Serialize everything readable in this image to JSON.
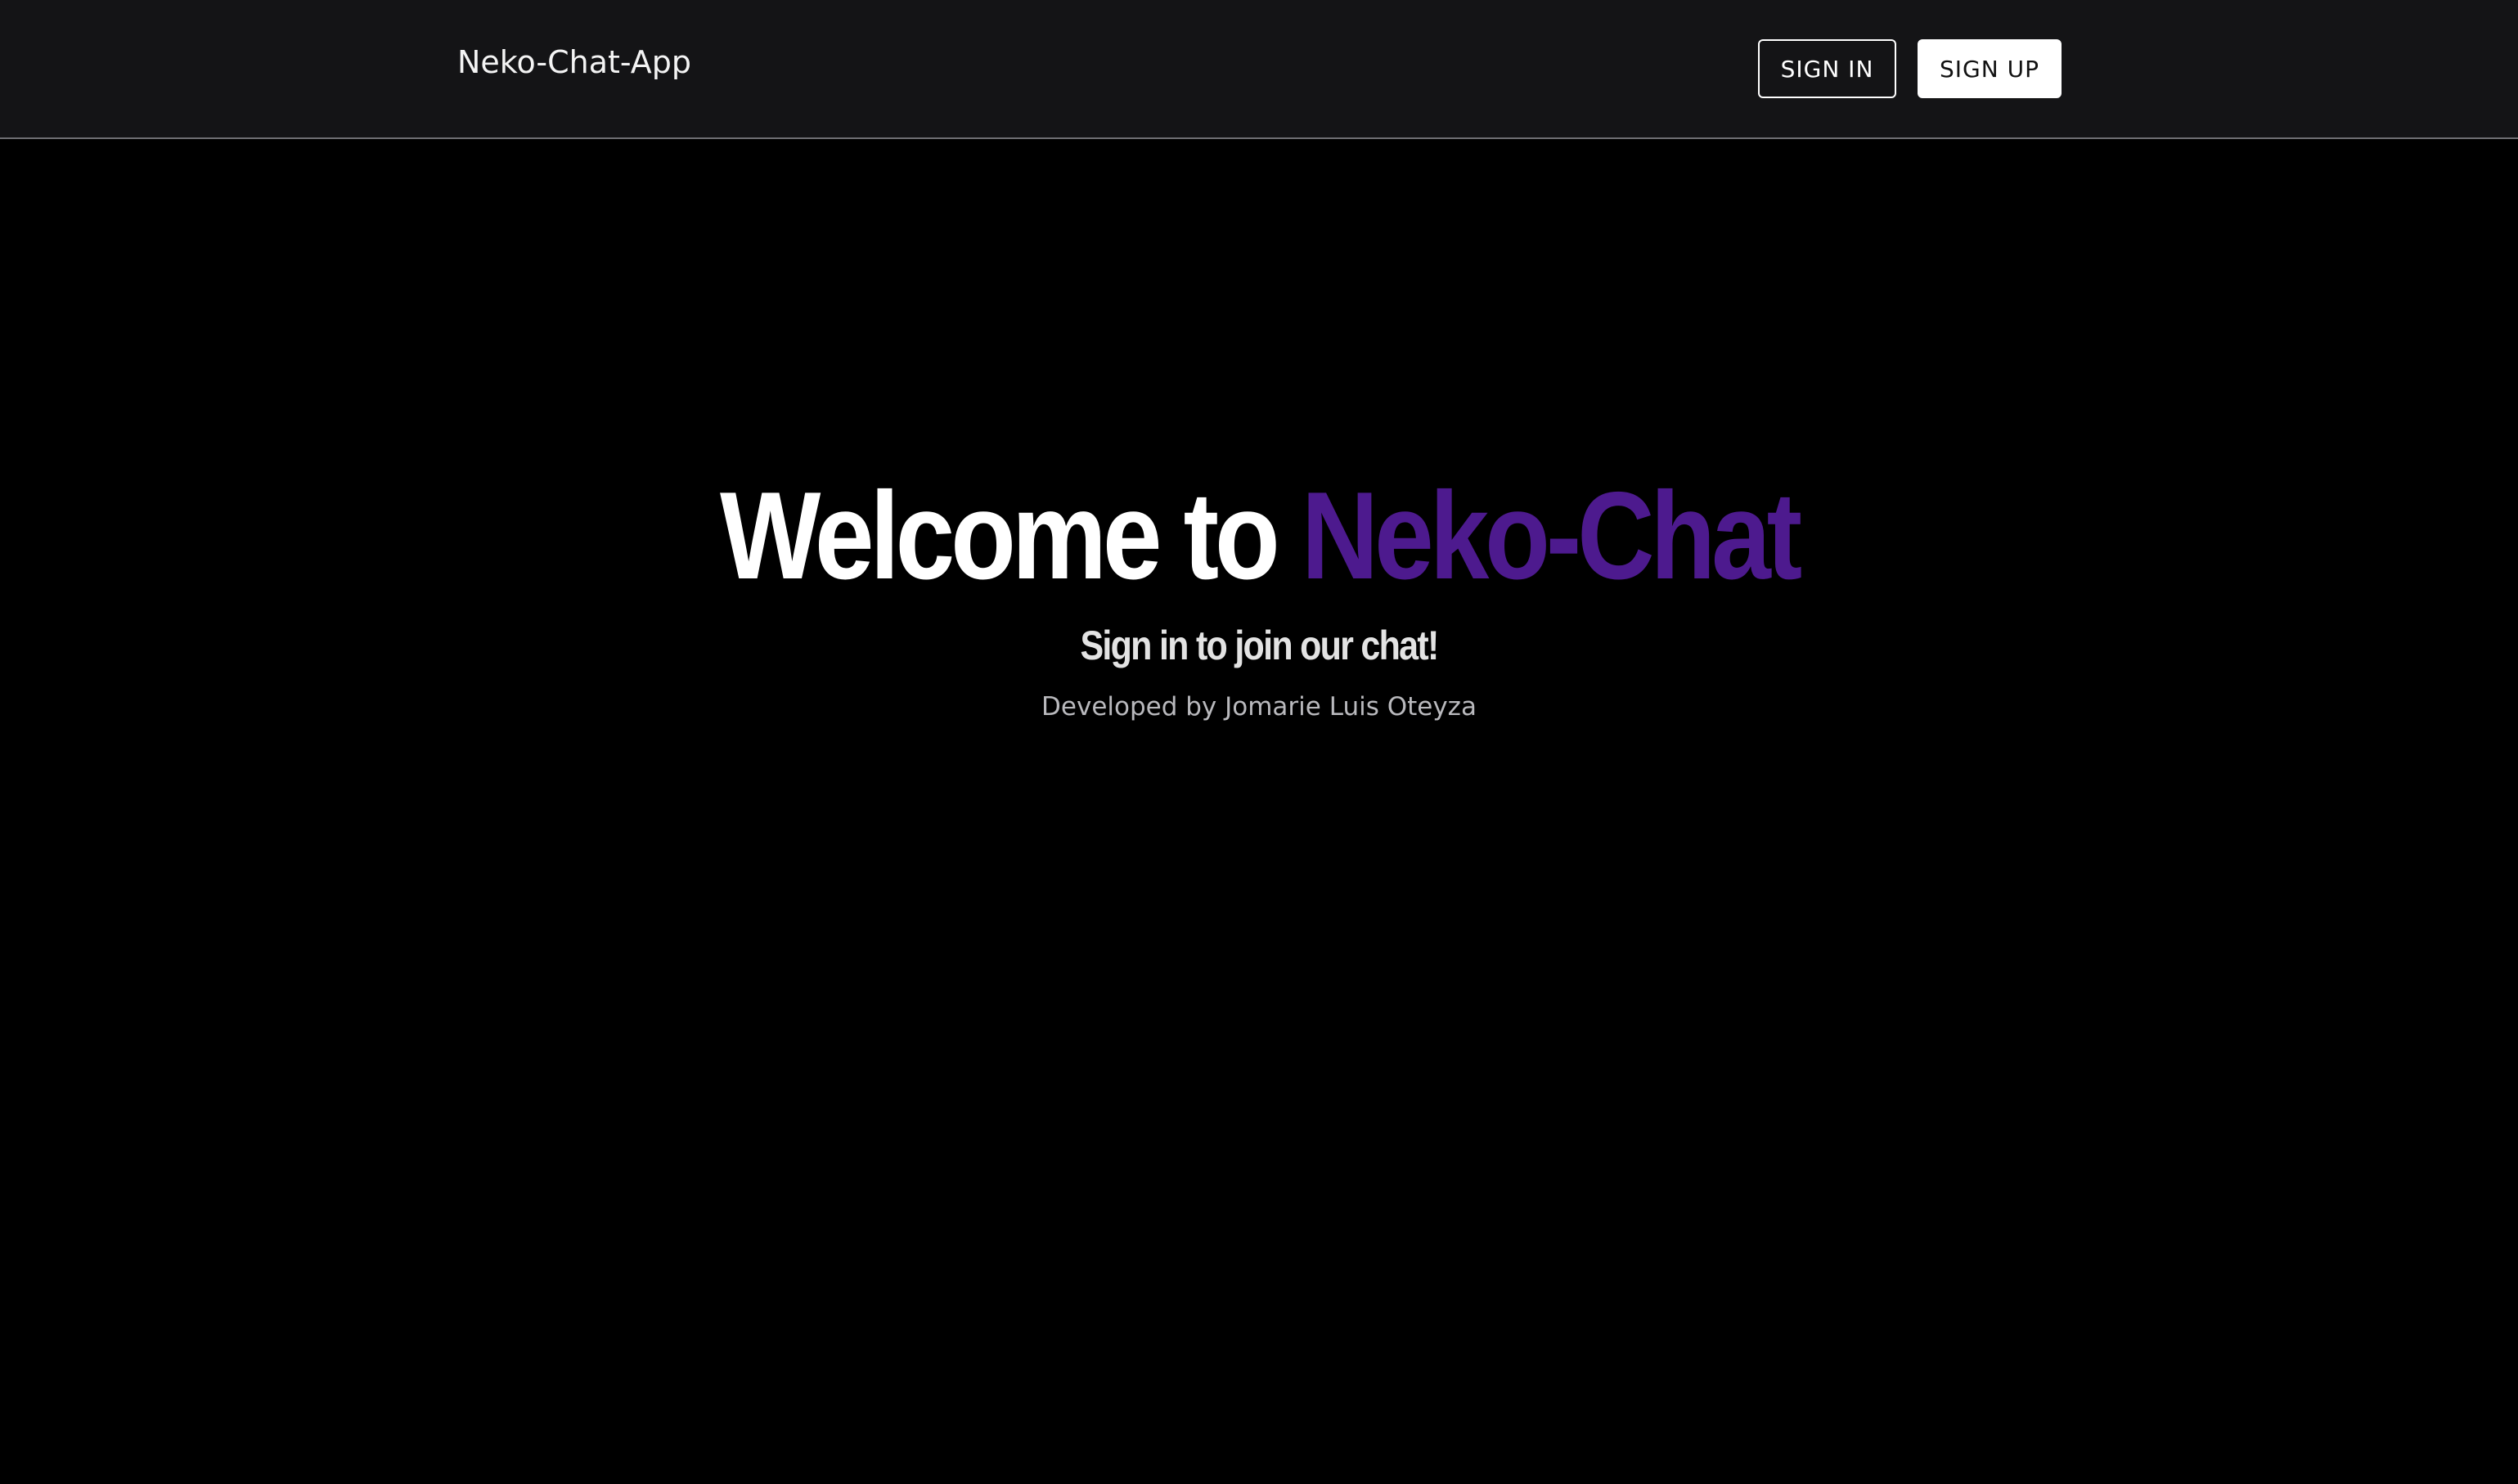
{
  "header": {
    "app_title": "Neko-Chat-App",
    "sign_in_label": "SIGN IN",
    "sign_up_label": "SIGN UP"
  },
  "hero": {
    "title_prefix": "Welcome to ",
    "title_accent": "Neko-Chat",
    "subtitle": "Sign in to join our chat!",
    "credit": "Developed by Jomarie Luis Oteyza"
  },
  "colors": {
    "page_background": "#000000",
    "header_background": "#141416",
    "accent": "#4d1a8e",
    "header_divider": "#6f6f73"
  }
}
